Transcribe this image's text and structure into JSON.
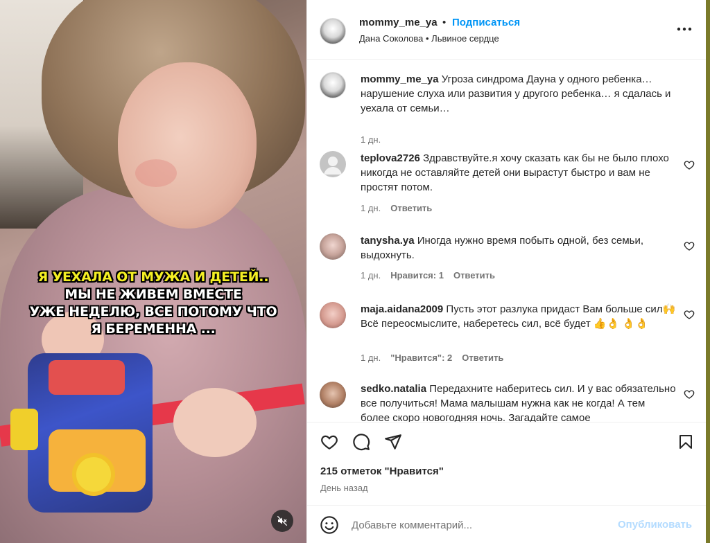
{
  "post": {
    "author": "mommy_me_ya",
    "dot": "•",
    "follow_label": "Подписаться",
    "subtitle": "Дана Соколова • Львиное сердце",
    "overlay_lines": [
      "Я УЕХАЛА ОТ МУЖА И ДЕТЕЙ..",
      "МЫ НЕ ЖИВЕМ ВМЕСТЕ",
      "УЖЕ НЕДЕЛЮ, ВСЕ ПОТОМУ ЧТО",
      "Я БЕРЕМЕННА ..."
    ],
    "caption": {
      "author": "mommy_me_ya",
      "text": "Угроза синдрома Дауна у одного ребенка… нарушение слуха или развития у другого ребенка… я сдалась и уехала от семьи…",
      "time": "1 дн."
    }
  },
  "comments": [
    {
      "author": "teplova2726",
      "text": "Здравствуйте.я хочу сказать как бы не было плохо никогда не оставляйте детей они вырастут быстро и вам не простят потом.",
      "time": "1 дн.",
      "likes": "",
      "reply": "Ответить"
    },
    {
      "author": "tanysha.ya",
      "text": "Иногда нужно время побыть одной, без семьи, выдохнуть.",
      "time": "1 дн.",
      "likes": "Нравится: 1",
      "reply": "Ответить"
    },
    {
      "author": "maja.aidana2009",
      "text": "Пусть этот разлука придаст Вам больше сил🙌 Всё переосмыслите, наберетесь сил, всё будет 👍👌 👌👌",
      "time": "1 дн.",
      "likes": "\"Нравится\": 2",
      "reply": "Ответить"
    },
    {
      "author": "sedko.natalia",
      "text": "Передахните наберитесь сил. И у вас обязательно все получиться! Мама малышам нужна как не когда! А тем более скоро новогодняя ночь. Загадайте самое",
      "time": "",
      "likes": "",
      "reply": ""
    }
  ],
  "stats": {
    "likes": "215 отметок \"Нравится\"",
    "date": "День назад"
  },
  "composer": {
    "placeholder": "Добавьте комментарий...",
    "publish": "Опубликовать"
  },
  "icons": {
    "more": "more-horizontal-icon",
    "like": "heart-icon",
    "comment": "comment-icon",
    "share": "send-icon",
    "save": "bookmark-icon",
    "emoji": "emoji-icon",
    "mute": "speaker-muted-icon"
  },
  "colors": {
    "accent": "#0095f6",
    "overlay_highlight": "#f4ef23",
    "muted_text": "#737373",
    "publish_disabled": "#b3dbff"
  }
}
